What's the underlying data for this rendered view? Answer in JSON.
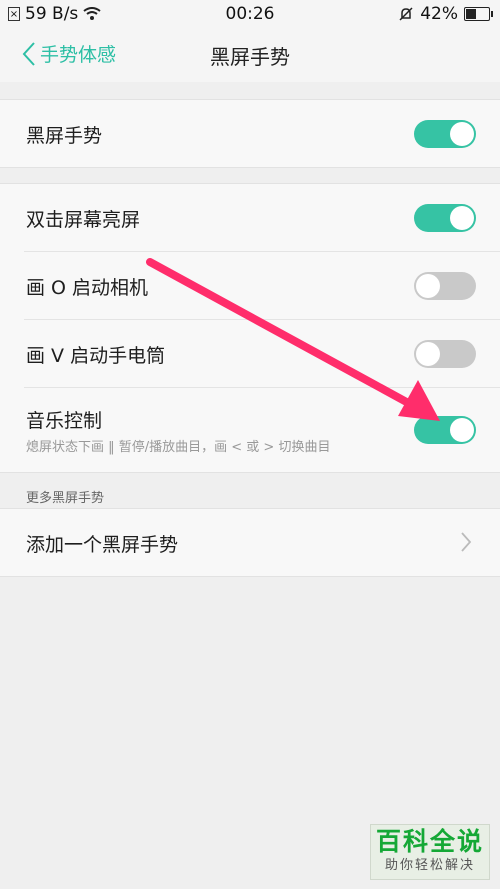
{
  "status_bar": {
    "speed": "59 B/s",
    "time": "00:26",
    "battery": "42%",
    "battery_level": 0.42,
    "icons": [
      "sim-icon",
      "wifi-icon",
      "silent-bell-icon",
      "battery-icon"
    ]
  },
  "nav": {
    "back_label": "手势体感",
    "title": "黑屏手势"
  },
  "group1": {
    "items": [
      {
        "label": "黑屏手势",
        "on": true
      }
    ]
  },
  "group2": {
    "items": [
      {
        "label": "双击屏幕亮屏",
        "on": true
      },
      {
        "label": "画 O 启动相机",
        "on": false
      },
      {
        "label": "画 V 启动手电筒",
        "on": false
      },
      {
        "label": "音乐控制",
        "sub": "熄屏状态下画 ‖ 暂停/播放曲目，画 < 或 > 切换曲目",
        "on": true
      }
    ]
  },
  "more": {
    "header": "更多黑屏手势",
    "add_label": "添加一个黑屏手势"
  },
  "colors": {
    "accent": "#36c3a4",
    "arrow": "#ff2d6b"
  },
  "watermark": {
    "title": "百科全说",
    "subtitle": "助你轻松解决"
  }
}
